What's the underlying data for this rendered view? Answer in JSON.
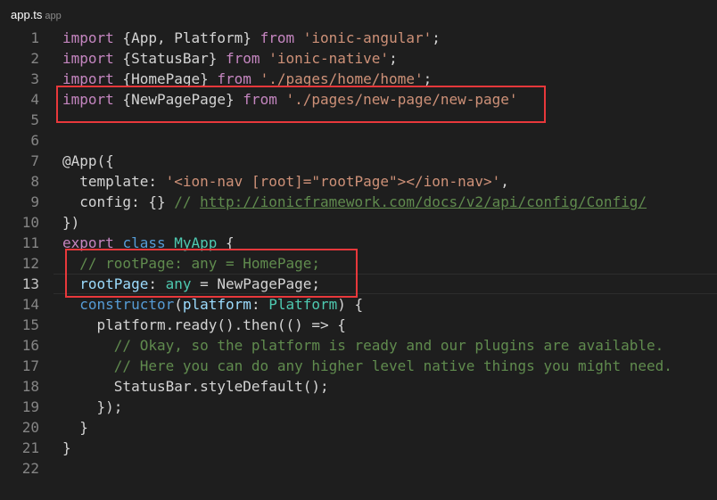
{
  "tab": {
    "filename": "app.ts",
    "description": "app"
  },
  "colors": {
    "background": "#1e1e1e",
    "keyword": "#c586c0",
    "storage": "#569cd6",
    "string": "#ce9178",
    "comment": "#608b4e",
    "type": "#4ec9b0",
    "variable": "#9cdcfe",
    "line_number": "#858585",
    "highlight_box": "#e8383b"
  },
  "code": {
    "lines": [
      {
        "number": "1",
        "tokens": [
          {
            "t": "import",
            "c": "keyword"
          },
          {
            "t": " {App, Platform} ",
            "c": "plain"
          },
          {
            "t": "from",
            "c": "keyword"
          },
          {
            "t": " ",
            "c": "plain"
          },
          {
            "t": "'ionic-angular'",
            "c": "string"
          },
          {
            "t": ";",
            "c": "plain"
          }
        ]
      },
      {
        "number": "2",
        "tokens": [
          {
            "t": "import",
            "c": "keyword"
          },
          {
            "t": " {StatusBar} ",
            "c": "plain"
          },
          {
            "t": "from",
            "c": "keyword"
          },
          {
            "t": " ",
            "c": "plain"
          },
          {
            "t": "'ionic-native'",
            "c": "string"
          },
          {
            "t": ";",
            "c": "plain"
          }
        ]
      },
      {
        "number": "3",
        "tokens": [
          {
            "t": "import",
            "c": "keyword"
          },
          {
            "t": " {HomePage} ",
            "c": "plain"
          },
          {
            "t": "from",
            "c": "keyword"
          },
          {
            "t": " ",
            "c": "plain"
          },
          {
            "t": "'./pages/home/home'",
            "c": "string"
          },
          {
            "t": ";",
            "c": "plain"
          }
        ]
      },
      {
        "number": "4",
        "tokens": [
          {
            "t": "import",
            "c": "keyword"
          },
          {
            "t": " {NewPagePage} ",
            "c": "plain"
          },
          {
            "t": "from",
            "c": "keyword"
          },
          {
            "t": " ",
            "c": "plain"
          },
          {
            "t": "'./pages/new-page/new-page'",
            "c": "string"
          }
        ]
      },
      {
        "number": "5",
        "tokens": []
      },
      {
        "number": "6",
        "tokens": []
      },
      {
        "number": "7",
        "tokens": [
          {
            "t": "@App({",
            "c": "plain"
          }
        ]
      },
      {
        "number": "8",
        "tokens": [
          {
            "t": "  template: ",
            "c": "plain"
          },
          {
            "t": "'<ion-nav [root]=\"rootPage\"></ion-nav>'",
            "c": "string"
          },
          {
            "t": ",",
            "c": "plain"
          }
        ]
      },
      {
        "number": "9",
        "tokens": [
          {
            "t": "  config: {} ",
            "c": "plain"
          },
          {
            "t": "// ",
            "c": "comment"
          },
          {
            "t": "http://ionicframework.com/docs/v2/api/config/Config/",
            "c": "link"
          }
        ]
      },
      {
        "number": "10",
        "tokens": [
          {
            "t": "})",
            "c": "plain"
          }
        ]
      },
      {
        "number": "11",
        "tokens": [
          {
            "t": "export",
            "c": "keyword"
          },
          {
            "t": " ",
            "c": "plain"
          },
          {
            "t": "class",
            "c": "storage"
          },
          {
            "t": " ",
            "c": "plain"
          },
          {
            "t": "MyApp",
            "c": "type"
          },
          {
            "t": " {",
            "c": "plain"
          }
        ]
      },
      {
        "number": "12",
        "tokens": [
          {
            "t": "  ",
            "c": "plain"
          },
          {
            "t": "// rootPage: any = HomePage;",
            "c": "comment"
          }
        ]
      },
      {
        "number": "13",
        "current": true,
        "tokens": [
          {
            "t": "  ",
            "c": "plain"
          },
          {
            "t": "rootPage",
            "c": "var"
          },
          {
            "t": ": ",
            "c": "plain"
          },
          {
            "t": "any",
            "c": "type"
          },
          {
            "t": " = NewPagePage;",
            "c": "plain"
          }
        ]
      },
      {
        "number": "14",
        "tokens": [
          {
            "t": "  ",
            "c": "plain"
          },
          {
            "t": "constructor",
            "c": "storage"
          },
          {
            "t": "(",
            "c": "plain"
          },
          {
            "t": "platform",
            "c": "var"
          },
          {
            "t": ": ",
            "c": "plain"
          },
          {
            "t": "Platform",
            "c": "type"
          },
          {
            "t": ") {",
            "c": "plain"
          }
        ]
      },
      {
        "number": "15",
        "tokens": [
          {
            "t": "    platform.ready().then(() => {",
            "c": "plain"
          }
        ]
      },
      {
        "number": "16",
        "tokens": [
          {
            "t": "      ",
            "c": "plain"
          },
          {
            "t": "// Okay, so the platform is ready and our plugins are available.",
            "c": "comment"
          }
        ]
      },
      {
        "number": "17",
        "tokens": [
          {
            "t": "      ",
            "c": "plain"
          },
          {
            "t": "// Here you can do any higher level native things you might need.",
            "c": "comment"
          }
        ]
      },
      {
        "number": "18",
        "tokens": [
          {
            "t": "      StatusBar.styleDefault();",
            "c": "plain"
          }
        ]
      },
      {
        "number": "19",
        "tokens": [
          {
            "t": "    });",
            "c": "plain"
          }
        ]
      },
      {
        "number": "20",
        "tokens": [
          {
            "t": "  }",
            "c": "plain"
          }
        ]
      },
      {
        "number": "21",
        "tokens": [
          {
            "t": "}",
            "c": "plain"
          }
        ]
      },
      {
        "number": "22",
        "tokens": []
      }
    ]
  }
}
